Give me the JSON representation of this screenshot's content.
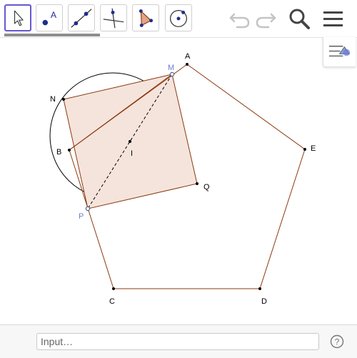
{
  "toolbar": {
    "tools": [
      {
        "name": "move-tool",
        "active": true
      },
      {
        "name": "point-tool",
        "glyph_label": "A"
      },
      {
        "name": "line-tool"
      },
      {
        "name": "perpendicular-line-tool"
      },
      {
        "name": "polygon-tool"
      },
      {
        "name": "circle-tool"
      }
    ],
    "undo_icon": "undo-icon",
    "redo_icon": "redo-icon",
    "search_icon": "search-icon",
    "menu_icon": "hamburger-menu-icon"
  },
  "style_bar": {
    "icon": "style-bar-toggle-icon"
  },
  "colors": {
    "accent": "#6557d2",
    "pentagon_stroke": "#8b3a0f",
    "square_fill": "#f5e4dc",
    "point_blue": "#6a7bd2"
  },
  "construction": {
    "points": {
      "A": "A",
      "B": "B",
      "C": "C",
      "D": "D",
      "E": "E",
      "M": "M",
      "N": "N",
      "P": "P",
      "Q": "Q",
      "I": "I"
    }
  },
  "input_bar": {
    "placeholder": "Input…",
    "help_icon": "help-icon"
  }
}
